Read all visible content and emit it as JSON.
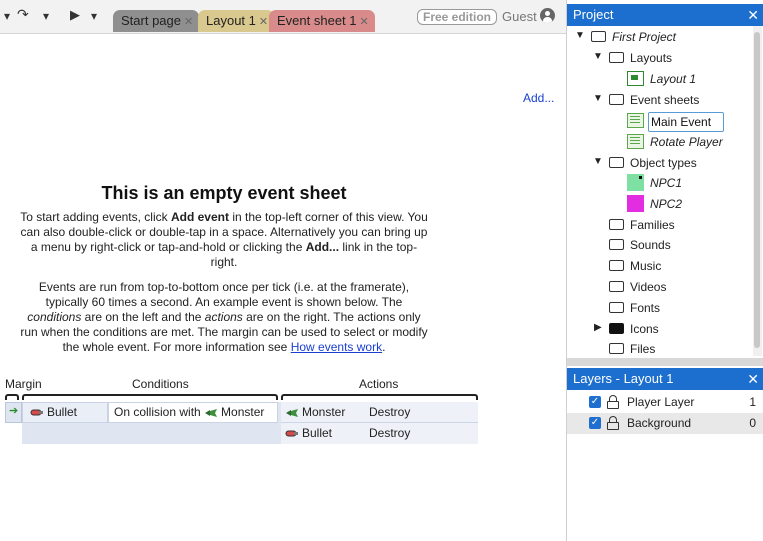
{
  "toolbar": {
    "undo_icon": "undo-arrow",
    "redo_icon": "redo-arrow",
    "run_icon": "play-triangle",
    "tabs": [
      {
        "label": "Start page",
        "color": "#8f8f8f"
      },
      {
        "label": "Layout 1",
        "color": "#d9c98f"
      },
      {
        "label": "Event sheet 1",
        "color": "#d98b8b"
      }
    ],
    "edition_badge": "Free edition",
    "user": "Guest"
  },
  "sheet": {
    "add_link": "Add...",
    "empty_title": "This is an empty event sheet",
    "p1": {
      "a": "To start adding events, click ",
      "b": "Add event",
      "c": " in the top-left corner of this view. You can also double-click or double-tap in a space. Alternatively you can bring up a menu by right-click or tap-and-hold or clicking the ",
      "d": "Add...",
      "e": " link in the top-right."
    },
    "p2": {
      "a": "Events are run from top-to-bottom once per tick (i.e. at the framerate), typically 60 times a second. An example event is shown below. The ",
      "b": "conditions",
      "c": " are on the left and the ",
      "d": "actions",
      "e": " are on the right. The actions only run when the conditions are met. The margin can be used to select or modify the whole event. For more information see ",
      "link": "How events work",
      "f": "."
    },
    "headers": {
      "margin": "Margin",
      "conditions": "Conditions",
      "actions": "Actions"
    },
    "event": {
      "condition_object": "Bullet",
      "condition_text": "On collision with",
      "condition_target": "Monster",
      "actions": [
        {
          "object": "Monster",
          "action": "Destroy"
        },
        {
          "object": "Bullet",
          "action": "Destroy"
        }
      ]
    }
  },
  "project": {
    "title": "Project",
    "tree": {
      "root": "First Project",
      "layouts_folder": "Layouts",
      "layout_1": "Layout 1",
      "event_sheets_folder": "Event sheets",
      "rename_value": "Main Event",
      "rotate_player": "Rotate Player",
      "object_types_folder": "Object types",
      "npc1": "NPC1",
      "npc2": "NPC2",
      "families": "Families",
      "sounds": "Sounds",
      "music": "Music",
      "videos": "Videos",
      "fonts": "Fonts",
      "icons": "Icons",
      "files": "Files"
    },
    "colors": {
      "npc1": "#7fe0a4",
      "npc2": "#e32de0",
      "event_sheet_icon": "#5aa84a"
    }
  },
  "layers": {
    "title": "Layers - Layout 1",
    "items": [
      {
        "name": "Player Layer",
        "index": "1"
      },
      {
        "name": "Background",
        "index": "0"
      }
    ]
  },
  "accent": "#1c6fce"
}
